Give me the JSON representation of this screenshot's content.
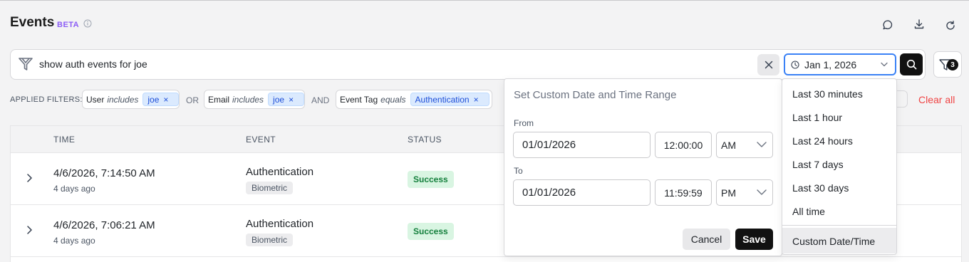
{
  "header": {
    "title": "Events",
    "badge": "BETA",
    "icons": [
      "info-icon",
      "comment-icon",
      "download-icon",
      "refresh-icon"
    ]
  },
  "search": {
    "query": "show auth events for joe",
    "date_value": "Jan 1, 2026",
    "filter_count": "3",
    "icons": [
      "brand-logo-icon",
      "close-icon",
      "clock-icon",
      "chevron-down-icon",
      "search-icon",
      "filter-icon"
    ]
  },
  "filters": {
    "label": "APPLIED FILTERS:",
    "chips": [
      {
        "field": "User",
        "op": "includes",
        "value": "joe"
      },
      {
        "field": "Email",
        "op": "includes",
        "value": "joe"
      },
      {
        "field": "Event Tag",
        "op": "equals",
        "value": "Authentication"
      }
    ],
    "conjunctions": [
      "OR",
      "AND"
    ],
    "remove_symbol": "×",
    "partial_button": "t",
    "clear_all": "Clear all"
  },
  "table": {
    "columns": [
      "TIME",
      "EVENT",
      "STATUS"
    ],
    "rows": [
      {
        "time": "4/6/2026, 7:14:50 AM",
        "ago": "4 days ago",
        "event": "Authentication",
        "tag": "Biometric",
        "status": "Success"
      },
      {
        "time": "4/6/2026, 7:06:21 AM",
        "ago": "4 days ago",
        "event": "Authentication",
        "tag": "Biometric",
        "status": "Success"
      }
    ]
  },
  "date_picker": {
    "title": "Set Custom Date and Time Range",
    "from_label": "From",
    "from_date": "01/01/2026",
    "from_time": "12:00:00",
    "from_ampm": "AM",
    "to_label": "To",
    "to_date": "01/01/2026",
    "to_time": "11:59:59",
    "to_ampm": "PM",
    "cancel": "Cancel",
    "save": "Save"
  },
  "presets": {
    "items": [
      "Last 30 minutes",
      "Last 1 hour",
      "Last 24 hours",
      "Last 7 days",
      "Last 30 days",
      "All time"
    ],
    "custom": "Custom Date/Time"
  },
  "colors": {
    "accent_purple": "#8b5cf6",
    "focus_blue": "#3b82f6",
    "danger": "#ef4444",
    "success_bg": "#d9f5e2",
    "success_text": "#15803d",
    "chip_value_bg": "#dbeafe"
  }
}
